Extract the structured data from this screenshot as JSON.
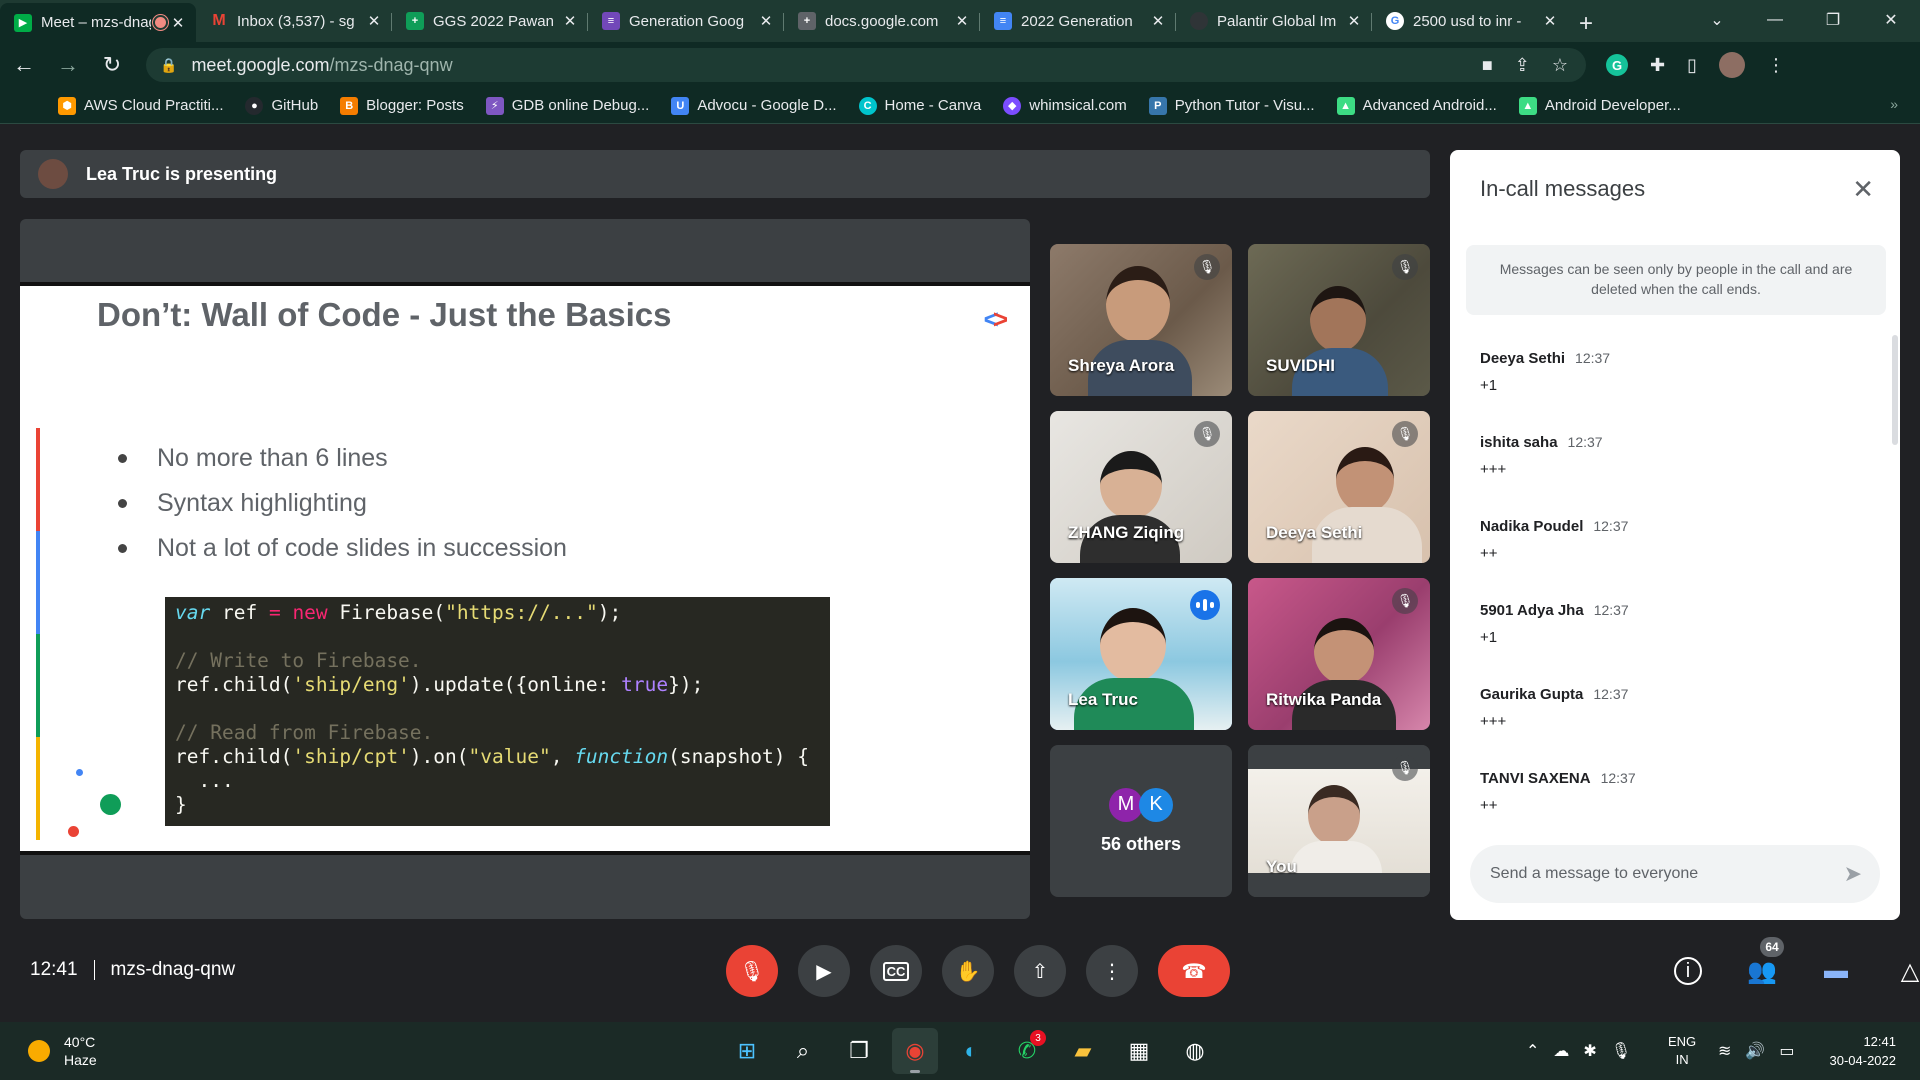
{
  "browser": {
    "tabs": [
      {
        "title": "Meet – mzs-dnag-qnw",
        "icon": "google-meet-icon",
        "color": "#00ac47",
        "active": true,
        "recording": true
      },
      {
        "title": "Inbox (3,537) - sg",
        "icon": "gmail-icon",
        "color": "#ea4335"
      },
      {
        "title": "GGS 2022 Pawan",
        "icon": "google-sheets-icon",
        "color": "#0f9d58"
      },
      {
        "title": "Generation Goog",
        "icon": "google-forms-icon",
        "color": "#7248b9"
      },
      {
        "title": "docs.google.com",
        "icon": "google-sheets-icon",
        "color": "#5f6368"
      },
      {
        "title": "2022 Generation",
        "icon": "google-docs-icon",
        "color": "#4285f4"
      },
      {
        "title": "Palantir Global Im",
        "icon": "palantir-icon",
        "color": "#3c4043"
      },
      {
        "title": "2500 usd to inr -",
        "icon": "google-search-icon",
        "color": "#ffffff"
      }
    ],
    "url_host": "meet.google.com",
    "url_path": "/mzs-dnag-qnw",
    "bookmarks": [
      {
        "label": "AWS Cloud Practiti...",
        "color": "#ff9900"
      },
      {
        "label": "GitHub",
        "color": "#24292e"
      },
      {
        "label": "Blogger: Posts",
        "color": "#f57d00"
      },
      {
        "label": "GDB online Debug...",
        "color": "#7e57c2"
      },
      {
        "label": "Advocu - Google D...",
        "color": "#4285f4"
      },
      {
        "label": "Home - Canva",
        "color": "#00c4cc"
      },
      {
        "label": "whimsical.com",
        "color": "#7c4dff"
      },
      {
        "label": "Python Tutor - Visu...",
        "color": "#3776ab"
      },
      {
        "label": "Advanced Android...",
        "color": "#3ddc84"
      },
      {
        "label": "Android Developer...",
        "color": "#3ddc84"
      }
    ]
  },
  "meet": {
    "presenting_label": "Lea Truc is presenting",
    "slide": {
      "title": "Don’t: Wall of Code - Just the Basics",
      "bullets": [
        "No more than 6 lines",
        "Syntax highlighting",
        "Not a lot of code slides in succession"
      ],
      "code": {
        "l1a": "var",
        "l1b": " ref ",
        "l1c": "=",
        "l1d": " ",
        "l1e": "new",
        "l1f": " Firebase(",
        "l1g": "\"https://...\"",
        "l1h": ");",
        "l2": "// Write to Firebase.",
        "l3a": "ref.child(",
        "l3b": "'ship/eng'",
        "l3c": ").update({online: ",
        "l3d": "true",
        "l3e": "});",
        "l4": "// Read from Firebase.",
        "l5a": "ref.child(",
        "l5b": "'ship/cpt'",
        "l5c": ").on(",
        "l5d": "\"value\"",
        "l5e": ", ",
        "l5f": "function",
        "l5g": "(snapshot) {",
        "l6": "  ...",
        "l7": "}"
      }
    },
    "participants": [
      {
        "name": "Shreya Arora",
        "muted": true
      },
      {
        "name": "SUVIDHI",
        "muted": true
      },
      {
        "name": "ZHANG Ziqing",
        "muted": true
      },
      {
        "name": "Deeya Sethi",
        "muted": true
      },
      {
        "name": "Lea Truc",
        "muted": false,
        "speaking": true
      },
      {
        "name": "Ritwika Panda",
        "muted": true
      },
      {
        "name": "You",
        "muted": true
      }
    ],
    "others": {
      "avatar1": "M",
      "avatar2": "K",
      "label": "56 others"
    },
    "chat": {
      "title": "In-call messages",
      "notice": "Messages can be seen only by people in the call and are deleted when the call ends.",
      "messages": [
        {
          "sender": "Deeya Sethi",
          "time": "12:37",
          "text": "+1"
        },
        {
          "sender": "ishita saha",
          "time": "12:37",
          "text": "+++"
        },
        {
          "sender": "Nadika Poudel",
          "time": "12:37",
          "text": "++"
        },
        {
          "sender": "5901 Adya Jha",
          "time": "12:37",
          "text": "+1"
        },
        {
          "sender": "Gaurika Gupta",
          "time": "12:37",
          "text": "+++"
        },
        {
          "sender": "TANVI SAXENA",
          "time": "12:37",
          "text": "++"
        }
      ],
      "input_placeholder": "Send a message to everyone"
    },
    "bottom": {
      "time": "12:41",
      "meeting_code": "mzs-dnag-qnw",
      "people_count": "64"
    }
  },
  "taskbar": {
    "temperature": "40°C",
    "condition": "Haze",
    "whatsapp_badge": "3",
    "lang1": "ENG",
    "lang2": "IN",
    "time": "12:41",
    "date": "30-04-2022"
  }
}
